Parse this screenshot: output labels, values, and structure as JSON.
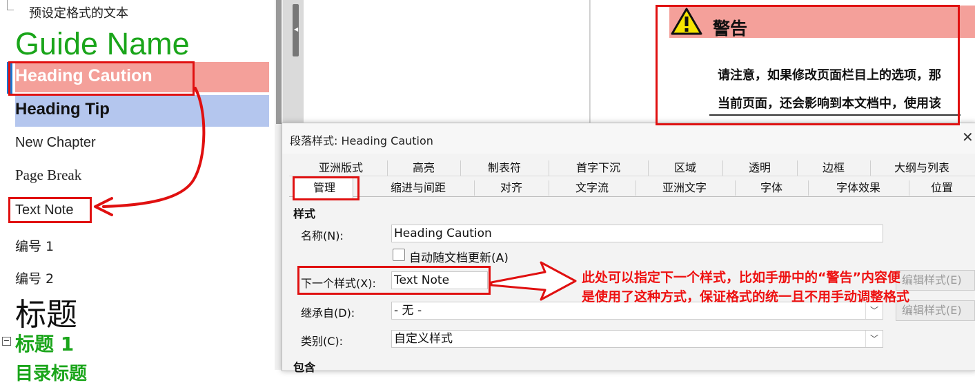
{
  "style_list": {
    "preset_text": "预设定格式的文本",
    "guide_name": "Guide Name",
    "heading_caution": "Heading Caution",
    "heading_tip": "Heading Tip",
    "new_chapter": "New Chapter",
    "page_break": "Page Break",
    "text_note": "Text Note",
    "numbering_1": "编号 1",
    "numbering_2": "编号 2",
    "title": "标题",
    "heading_1": "标题 1",
    "toc_heading": "目录标题"
  },
  "document": {
    "warning_title": "警告",
    "warning_line1": "请注意，如果修改页面栏目上的选项，那",
    "warning_line2": "当前页面，还会影响到本文档中，使用该"
  },
  "dialog": {
    "title": "段落样式: Heading Caution",
    "close_label": "✕",
    "tabs_row1": [
      "亚洲版式",
      "高亮",
      "制表符",
      "首字下沉",
      "区域",
      "透明",
      "边框",
      "大纲与列表"
    ],
    "tabs_row2": [
      "管理",
      "缩进与间距",
      "对齐",
      "文字流",
      "亚洲文字",
      "字体",
      "字体效果",
      "位置"
    ],
    "section_style": "样式",
    "name_label": "名称(N):",
    "name_value": "Heading Caution",
    "auto_update_label": "自动随文档更新(A)",
    "next_style_label": "下一个样式(X):",
    "next_style_value": "Text Note",
    "edit_style_button_1": "编辑样式(E)",
    "inherit_label": "继承自(D):",
    "inherit_value": "- 无 -",
    "edit_style_button_2": "编辑样式(E)",
    "category_label": "类别(C):",
    "category_value": "自定义样式",
    "section_contains": "包含"
  },
  "annotation": {
    "line1": "此处可以指定下一个样式，比如手册中的“警告”内容便",
    "line2": "是使用了这种方式，保证格式的统一且不用手动调整格式"
  },
  "colors": {
    "annotation_red": "#e01010",
    "caution_fill": "#f4a09a",
    "tip_fill": "#b4c6ee",
    "guide_green": "#1aa51a"
  },
  "icons": {
    "warning": "warning-triangle-icon",
    "collapse": "collapse-minus-icon",
    "dropdown": "chevron-down-icon"
  }
}
